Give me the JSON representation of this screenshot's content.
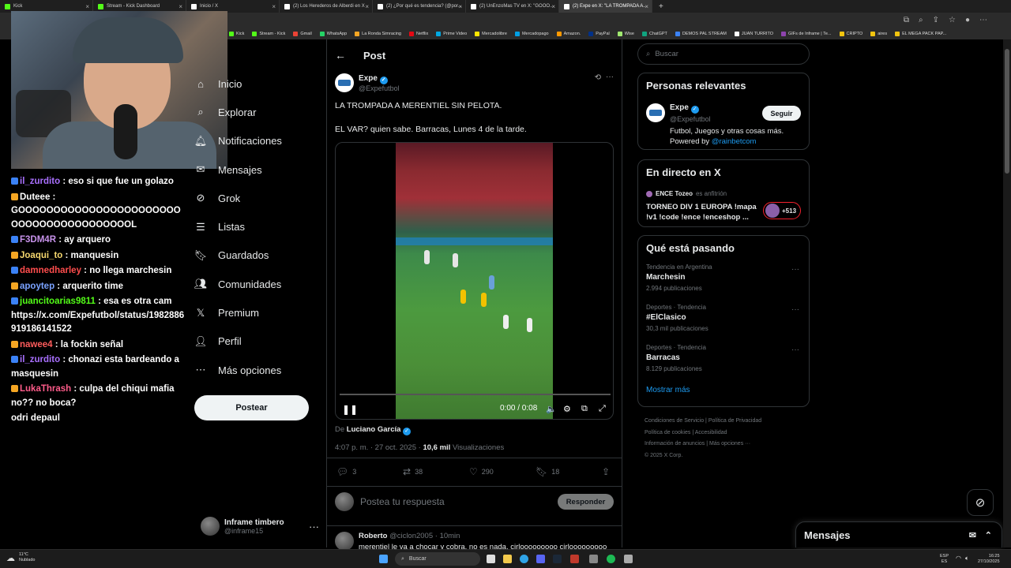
{
  "browser": {
    "tabs": [
      {
        "title": "Kick",
        "color": "#53fc18",
        "active": false
      },
      {
        "title": "Stream - Kick Dashboard",
        "color": "#53fc18",
        "active": false
      },
      {
        "title": "Inicio / X",
        "color": "#ffffff",
        "active": false
      },
      {
        "title": "(2) Los Herederos de Alberdi en X",
        "color": "#ffffff",
        "active": false
      },
      {
        "title": "(2) ¿Por qué es tendencia? (@por...",
        "color": "#ffffff",
        "active": false
      },
      {
        "title": "(2) UnEnzoMas TV en X: \"GOOO...",
        "color": "#ffffff",
        "active": false
      },
      {
        "title": "(2) Expe en X: \"LA TROMPADA A...",
        "color": "#ffffff",
        "active": true
      }
    ],
    "new_tab": "+",
    "bookmarks": [
      "Kick",
      "Stream - Kick",
      "Gmail",
      "WhatsApp",
      "La Ronda Simracing",
      "Netflix",
      "Prime Video",
      "Mercadolibre",
      "Mercadopago",
      "Amazon.",
      "PayPal",
      "Wise",
      "ChatGPT",
      "DEMOS PAL STREAM",
      "JUAN TURRITO",
      "GIFs de Inframe | Te...",
      "CRIPTO",
      "aires",
      "EL MEGA PACK PAP..."
    ]
  },
  "chat": [
    {
      "user": "il_zurdito",
      "color": "#a970ff",
      "text": "eso si que fue un golazo"
    },
    {
      "user": "Duteee",
      "color": "#ffffff",
      "text": "GOOOOOOOOOOOOOOOOOOOOOOOOOOOOOOOOOOOOOOOOL"
    },
    {
      "user": "F3DM4R",
      "color": "#c792ea",
      "text": "ay arquero"
    },
    {
      "user": "Joaqui_to",
      "color": "#f5d76e",
      "text": "manquesin"
    },
    {
      "user": "damnedharley",
      "color": "#ff4d4d",
      "text": "no llega marchesin"
    },
    {
      "user": "apoytep",
      "color": "#7aa2ff",
      "text": "arquerito time"
    },
    {
      "user": "juancitoarias9811",
      "color": "#53fc18",
      "text": "esa es otra cam https://x.com/Expefutbol/status/1982886919186141522"
    },
    {
      "user": "nawee4",
      "color": "#ff5c5c",
      "text": "la fockin señal"
    },
    {
      "user": "il_zurdito",
      "color": "#a970ff",
      "text": "chonazi esta bardeando a masquesin"
    },
    {
      "user": "LukaThrash",
      "color": "#ff5c8a",
      "text": "culpa del chiqui mafia no?? no boca?"
    },
    {
      "user": "",
      "color": "#ffffff",
      "text": "odri depaul"
    }
  ],
  "nav": {
    "items": [
      {
        "label": "Inicio",
        "icon": "home-icon"
      },
      {
        "label": "Explorar",
        "icon": "search-icon"
      },
      {
        "label": "Notificaciones",
        "icon": "bell-icon"
      },
      {
        "label": "Mensajes",
        "icon": "mail-icon"
      },
      {
        "label": "Grok",
        "icon": "grok-icon"
      },
      {
        "label": "Listas",
        "icon": "list-icon"
      },
      {
        "label": "Guardados",
        "icon": "bookmark-icon"
      },
      {
        "label": "Comunidades",
        "icon": "people-icon"
      },
      {
        "label": "Premium",
        "icon": "x-logo-icon"
      },
      {
        "label": "Perfil",
        "icon": "person-icon"
      },
      {
        "label": "Más opciones",
        "icon": "more-circle-icon"
      }
    ],
    "post_button": "Postear",
    "account": {
      "name": "Inframe timbero",
      "handle": "@inframe15"
    }
  },
  "post": {
    "header": "Post",
    "author": "Expe",
    "handle": "@Expefutbol",
    "text_1": "LA TROMPADA A MERENTIEL SIN PELOTA.",
    "text_2": "EL VAR? quien sabe. Barracas, Lunes 4 de la tarde.",
    "video_time": "0:00 / 0:08",
    "video_progress": 0,
    "from_prefix": "De",
    "from_user": "Luciano García",
    "timestamp": "4:07 p. m. · 27 oct. 2025 ·",
    "views": "10,6 mil",
    "views_label": "Visualizaciones",
    "replies": "3",
    "reposts": "38",
    "likes": "290",
    "bookmarks": "18",
    "reply_placeholder": "Postea tu respuesta",
    "reply_button": "Responder",
    "next_reply": {
      "name": "Roberto",
      "handle": "@ciclon2005 · 10min",
      "text": "merentiel le va a chocar y cobra, no es nada, cirlooooooooo cirlooooooooo"
    }
  },
  "right": {
    "search_placeholder": "Buscar",
    "relevant": {
      "title": "Personas relevantes",
      "name": "Expe",
      "handle": "@Expefutbol",
      "follow": "Seguir",
      "bio": "Futbol, Juegos y otras cosas más.",
      "powered_by": "Powered by",
      "powered_link": "@rainbetcom"
    },
    "live": {
      "title": "En directo en X",
      "host": "ENCE Tozeo",
      "host_role": "es anfitrión",
      "text": "TORNEO DIV 1 EUROPA !mapa !v1 !code !ence !enceshop ...",
      "listeners": "+513"
    },
    "trends": {
      "title": "Qué está pasando",
      "items": [
        {
          "context": "Tendencia en Argentina",
          "name": "Marchesin",
          "count": "2.994 publicaciones"
        },
        {
          "context": "Deportes · Tendencia",
          "name": "#ElClasico",
          "count": "30,3 mil publicaciones"
        },
        {
          "context": "Deportes · Tendencia",
          "name": "Barracas",
          "count": "8.129 publicaciones"
        }
      ],
      "more": "Mostrar más"
    },
    "footer": [
      "Condiciones de Servicio",
      "Política de Privacidad",
      "Política de cookies",
      "Accesibilidad",
      "Información de anuncios",
      "Más opciones ···",
      "© 2025 X Corp."
    ]
  },
  "messages_dock": "Mensajes",
  "taskbar": {
    "weather_temp": "11°C",
    "weather_text": "Nublado",
    "search": "Buscar",
    "lang_1": "ESP",
    "lang_2": "ES",
    "time": "16:25",
    "date": "27/10/2025"
  }
}
